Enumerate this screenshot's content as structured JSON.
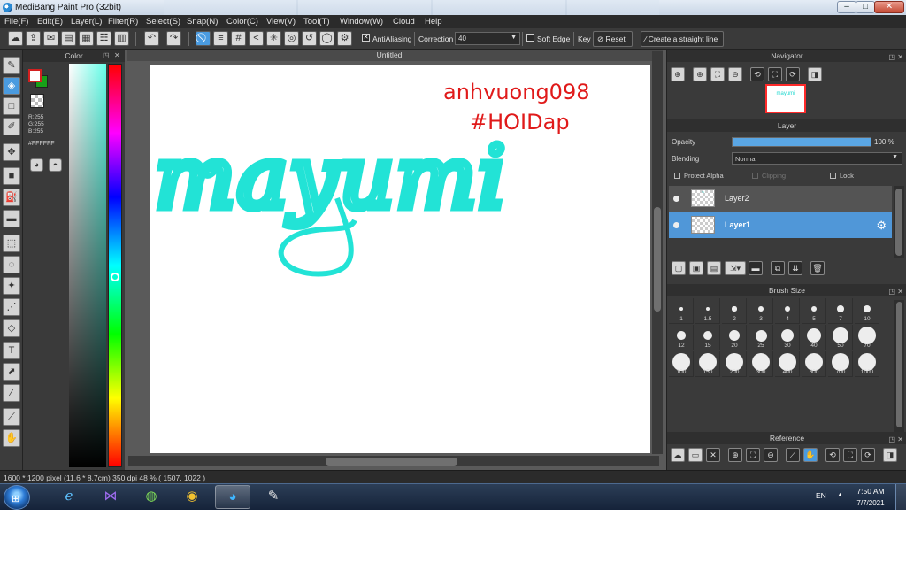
{
  "window": {
    "title": "MediBang Paint Pro (32bit)",
    "controls": {
      "minimize": "–",
      "maximize": "□",
      "close": "✕"
    }
  },
  "menu": [
    "File(F)",
    "Edit(E)",
    "Layer(L)",
    "Filter(R)",
    "Select(S)",
    "Snap(N)",
    "Color(C)",
    "View(V)",
    "Tool(T)",
    "Window(W)",
    "Cloud",
    "Help"
  ],
  "toolbar": {
    "antialiasing_label": "AntiAliasing",
    "antialiasing_checked": true,
    "correction_label": "Correction",
    "correction_value": "40",
    "soft_edge_label": "Soft Edge",
    "soft_edge_checked": false,
    "key_label": "Key",
    "reset_label": "Reset",
    "straight_line_label": "Create a straight line"
  },
  "color_panel": {
    "title": "Color",
    "r": "R:255",
    "g": "G:255",
    "b": "B:255",
    "hex": "#FFFFFF",
    "colors": {
      "foreground": "#ffffff",
      "background": "#18a018",
      "stroke_accent": "#d42020"
    }
  },
  "document": {
    "tab_title": "Untitled",
    "canvas_text": {
      "main_word": "mayumi",
      "signature_line1": "anhvuong098",
      "signature_line2": "#HOIDap",
      "main_color": "#22e3d6",
      "signature_color": "#e01a1a"
    }
  },
  "navigator": {
    "title": "Navigator"
  },
  "layer_panel": {
    "title": "Layer",
    "opacity_label": "Opacity",
    "opacity_value": "100 %",
    "opacity_fraction": 1.0,
    "blending_label": "Blending",
    "blending_value": "Normal",
    "protect_alpha_label": "Protect Alpha",
    "clipping_label": "Clipping",
    "lock_label": "Lock",
    "layers": [
      {
        "name": "Layer2",
        "selected": false
      },
      {
        "name": "Layer1",
        "selected": true
      }
    ]
  },
  "brush_size": {
    "title": "Brush Size",
    "sizes": [
      "1",
      "1.5",
      "2",
      "3",
      "4",
      "5",
      "7",
      "10",
      "12",
      "15",
      "20",
      "25",
      "30",
      "40",
      "50",
      "70",
      "100",
      "150",
      "200",
      "300",
      "400",
      "500",
      "700",
      "1000"
    ]
  },
  "reference": {
    "title": "Reference"
  },
  "status": {
    "text": "1600 * 1200 pixel   (11.6 * 8.7cm)   350 dpi   48 %   ( 1507, 1022 )"
  },
  "taskbar": {
    "apps": [
      "internet-explorer",
      "visual-studio",
      "coccoc",
      "chrome",
      "medibang-open",
      "paint-brush"
    ],
    "language": "EN",
    "time": "7:50 AM",
    "date": "7/7/2021"
  }
}
